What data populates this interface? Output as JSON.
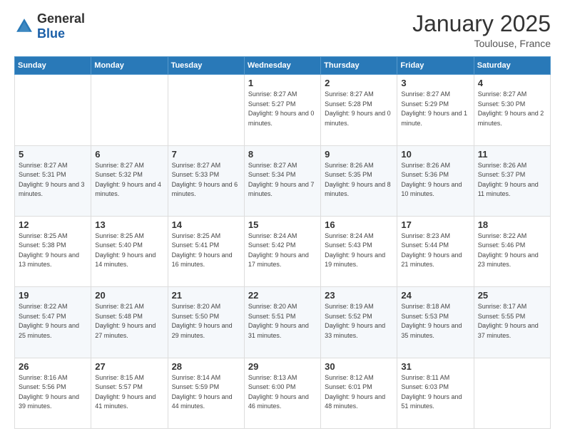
{
  "logo": {
    "general": "General",
    "blue": "Blue"
  },
  "header": {
    "month": "January 2025",
    "location": "Toulouse, France"
  },
  "weekdays": [
    "Sunday",
    "Monday",
    "Tuesday",
    "Wednesday",
    "Thursday",
    "Friday",
    "Saturday"
  ],
  "weeks": [
    [
      {
        "day": "",
        "sunrise": "",
        "sunset": "",
        "daylight": ""
      },
      {
        "day": "",
        "sunrise": "",
        "sunset": "",
        "daylight": ""
      },
      {
        "day": "",
        "sunrise": "",
        "sunset": "",
        "daylight": ""
      },
      {
        "day": "1",
        "sunrise": "Sunrise: 8:27 AM",
        "sunset": "Sunset: 5:27 PM",
        "daylight": "Daylight: 9 hours and 0 minutes."
      },
      {
        "day": "2",
        "sunrise": "Sunrise: 8:27 AM",
        "sunset": "Sunset: 5:28 PM",
        "daylight": "Daylight: 9 hours and 0 minutes."
      },
      {
        "day": "3",
        "sunrise": "Sunrise: 8:27 AM",
        "sunset": "Sunset: 5:29 PM",
        "daylight": "Daylight: 9 hours and 1 minute."
      },
      {
        "day": "4",
        "sunrise": "Sunrise: 8:27 AM",
        "sunset": "Sunset: 5:30 PM",
        "daylight": "Daylight: 9 hours and 2 minutes."
      }
    ],
    [
      {
        "day": "5",
        "sunrise": "Sunrise: 8:27 AM",
        "sunset": "Sunset: 5:31 PM",
        "daylight": "Daylight: 9 hours and 3 minutes."
      },
      {
        "day": "6",
        "sunrise": "Sunrise: 8:27 AM",
        "sunset": "Sunset: 5:32 PM",
        "daylight": "Daylight: 9 hours and 4 minutes."
      },
      {
        "day": "7",
        "sunrise": "Sunrise: 8:27 AM",
        "sunset": "Sunset: 5:33 PM",
        "daylight": "Daylight: 9 hours and 6 minutes."
      },
      {
        "day": "8",
        "sunrise": "Sunrise: 8:27 AM",
        "sunset": "Sunset: 5:34 PM",
        "daylight": "Daylight: 9 hours and 7 minutes."
      },
      {
        "day": "9",
        "sunrise": "Sunrise: 8:26 AM",
        "sunset": "Sunset: 5:35 PM",
        "daylight": "Daylight: 9 hours and 8 minutes."
      },
      {
        "day": "10",
        "sunrise": "Sunrise: 8:26 AM",
        "sunset": "Sunset: 5:36 PM",
        "daylight": "Daylight: 9 hours and 10 minutes."
      },
      {
        "day": "11",
        "sunrise": "Sunrise: 8:26 AM",
        "sunset": "Sunset: 5:37 PM",
        "daylight": "Daylight: 9 hours and 11 minutes."
      }
    ],
    [
      {
        "day": "12",
        "sunrise": "Sunrise: 8:25 AM",
        "sunset": "Sunset: 5:38 PM",
        "daylight": "Daylight: 9 hours and 13 minutes."
      },
      {
        "day": "13",
        "sunrise": "Sunrise: 8:25 AM",
        "sunset": "Sunset: 5:40 PM",
        "daylight": "Daylight: 9 hours and 14 minutes."
      },
      {
        "day": "14",
        "sunrise": "Sunrise: 8:25 AM",
        "sunset": "Sunset: 5:41 PM",
        "daylight": "Daylight: 9 hours and 16 minutes."
      },
      {
        "day": "15",
        "sunrise": "Sunrise: 8:24 AM",
        "sunset": "Sunset: 5:42 PM",
        "daylight": "Daylight: 9 hours and 17 minutes."
      },
      {
        "day": "16",
        "sunrise": "Sunrise: 8:24 AM",
        "sunset": "Sunset: 5:43 PM",
        "daylight": "Daylight: 9 hours and 19 minutes."
      },
      {
        "day": "17",
        "sunrise": "Sunrise: 8:23 AM",
        "sunset": "Sunset: 5:44 PM",
        "daylight": "Daylight: 9 hours and 21 minutes."
      },
      {
        "day": "18",
        "sunrise": "Sunrise: 8:22 AM",
        "sunset": "Sunset: 5:46 PM",
        "daylight": "Daylight: 9 hours and 23 minutes."
      }
    ],
    [
      {
        "day": "19",
        "sunrise": "Sunrise: 8:22 AM",
        "sunset": "Sunset: 5:47 PM",
        "daylight": "Daylight: 9 hours and 25 minutes."
      },
      {
        "day": "20",
        "sunrise": "Sunrise: 8:21 AM",
        "sunset": "Sunset: 5:48 PM",
        "daylight": "Daylight: 9 hours and 27 minutes."
      },
      {
        "day": "21",
        "sunrise": "Sunrise: 8:20 AM",
        "sunset": "Sunset: 5:50 PM",
        "daylight": "Daylight: 9 hours and 29 minutes."
      },
      {
        "day": "22",
        "sunrise": "Sunrise: 8:20 AM",
        "sunset": "Sunset: 5:51 PM",
        "daylight": "Daylight: 9 hours and 31 minutes."
      },
      {
        "day": "23",
        "sunrise": "Sunrise: 8:19 AM",
        "sunset": "Sunset: 5:52 PM",
        "daylight": "Daylight: 9 hours and 33 minutes."
      },
      {
        "day": "24",
        "sunrise": "Sunrise: 8:18 AM",
        "sunset": "Sunset: 5:53 PM",
        "daylight": "Daylight: 9 hours and 35 minutes."
      },
      {
        "day": "25",
        "sunrise": "Sunrise: 8:17 AM",
        "sunset": "Sunset: 5:55 PM",
        "daylight": "Daylight: 9 hours and 37 minutes."
      }
    ],
    [
      {
        "day": "26",
        "sunrise": "Sunrise: 8:16 AM",
        "sunset": "Sunset: 5:56 PM",
        "daylight": "Daylight: 9 hours and 39 minutes."
      },
      {
        "day": "27",
        "sunrise": "Sunrise: 8:15 AM",
        "sunset": "Sunset: 5:57 PM",
        "daylight": "Daylight: 9 hours and 41 minutes."
      },
      {
        "day": "28",
        "sunrise": "Sunrise: 8:14 AM",
        "sunset": "Sunset: 5:59 PM",
        "daylight": "Daylight: 9 hours and 44 minutes."
      },
      {
        "day": "29",
        "sunrise": "Sunrise: 8:13 AM",
        "sunset": "Sunset: 6:00 PM",
        "daylight": "Daylight: 9 hours and 46 minutes."
      },
      {
        "day": "30",
        "sunrise": "Sunrise: 8:12 AM",
        "sunset": "Sunset: 6:01 PM",
        "daylight": "Daylight: 9 hours and 48 minutes."
      },
      {
        "day": "31",
        "sunrise": "Sunrise: 8:11 AM",
        "sunset": "Sunset: 6:03 PM",
        "daylight": "Daylight: 9 hours and 51 minutes."
      },
      {
        "day": "",
        "sunrise": "",
        "sunset": "",
        "daylight": ""
      }
    ]
  ]
}
